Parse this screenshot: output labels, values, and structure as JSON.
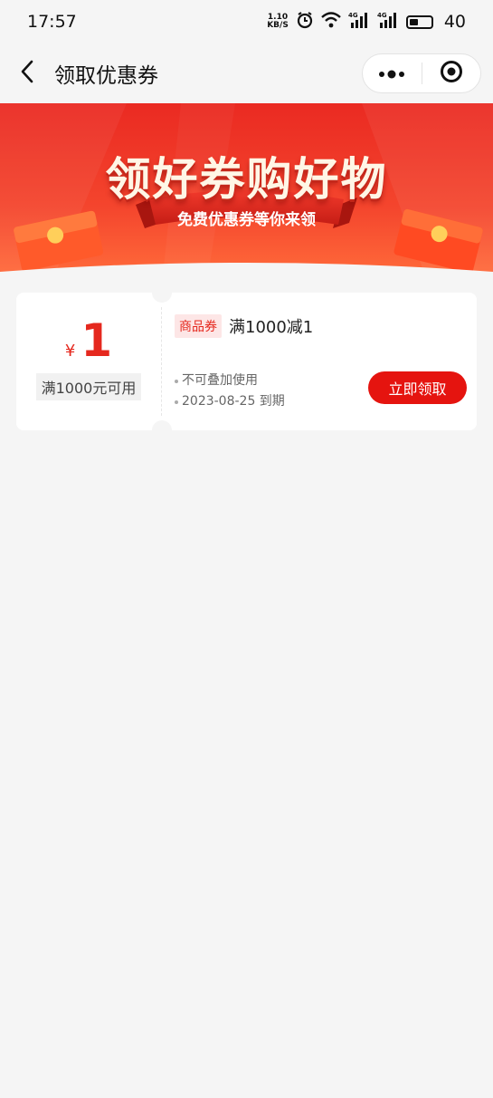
{
  "status_bar": {
    "time": "17:57",
    "net_speed_value": "1.10",
    "net_speed_unit": "KB/S",
    "sim1": "4G",
    "sim2": "4G",
    "battery": "40"
  },
  "nav": {
    "title": "领取优惠券",
    "back_icon": "chevron-left-icon",
    "more_icon": "more-dots-icon",
    "close_icon": "target-circle-icon"
  },
  "banner": {
    "headline": "领好券购好物",
    "ribbon": "免费优惠券等你来领",
    "colors": {
      "primary": "#f0362a",
      "secondary": "#ff6a3a",
      "ribbon": "#d8261c"
    }
  },
  "coupon": {
    "currency": "¥",
    "amount": "1",
    "min_spend": "满1000元可用",
    "tag": "商品券",
    "title": "满1000减1",
    "rules": [
      "不可叠加使用",
      "2023-08-25 到期"
    ],
    "claim_label": "立即领取",
    "accent": "#e5140f"
  }
}
